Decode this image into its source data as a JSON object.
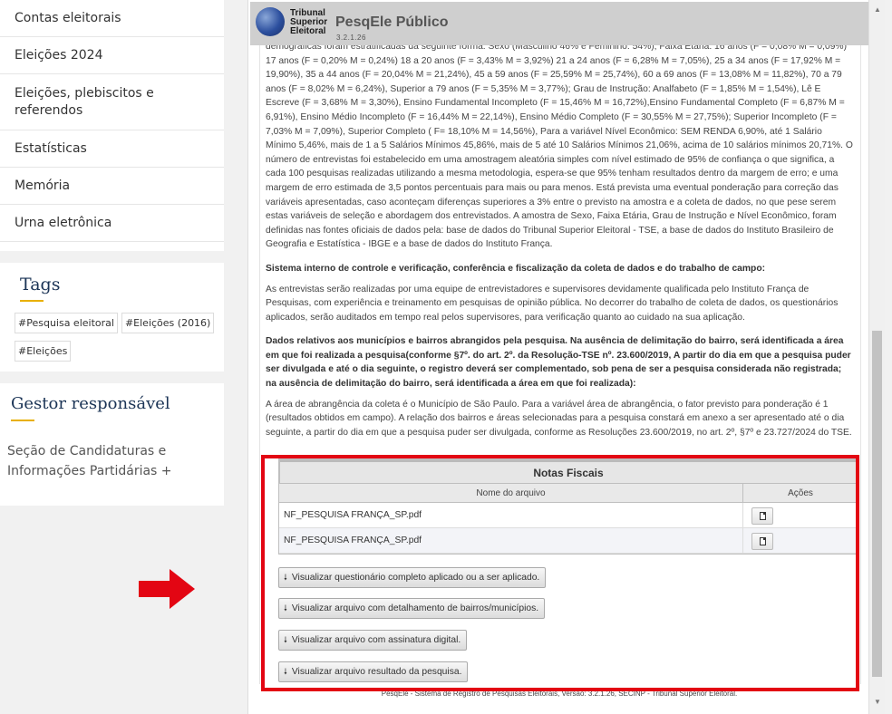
{
  "sidebar": {
    "items": [
      {
        "label": "Contas eleitorais"
      },
      {
        "label": "Eleições 2024"
      },
      {
        "label": "Eleições, plebiscitos e referendos"
      },
      {
        "label": "Estatísticas"
      },
      {
        "label": "Memória"
      },
      {
        "label": "Urna eletrônica"
      }
    ]
  },
  "tags": {
    "title": "Tags",
    "items": [
      "#Pesquisa eleitoral",
      "#Eleições (2016)",
      "#Eleições"
    ]
  },
  "gestor": {
    "title": "Gestor responsável",
    "text": "Seção de Candidaturas e Informações Partidárias +"
  },
  "app": {
    "logo_line1": "Tribunal",
    "logo_line2": "Superior",
    "logo_line3": "Eleitoral",
    "title": "PesqEle Público",
    "version": "3.2.1.26"
  },
  "content": {
    "para1": "demográficas foram estratificadas da seguinte forma: Sexo (Masculino 46% e Feminino: 54%); Faixa Etária: 16 anos (F = 0,08% M = 0,09%) 17 anos (F = 0,20% M = 0,24%) 18 a 20 anos (F = 3,43% M = 3,92%) 21 a 24 anos (F = 6,28% M = 7,05%), 25 a 34 anos (F = 17,92% M = 19,90%), 35 a 44 anos (F = 20,04% M = 21,24%), 45 a 59 anos (F = 25,59% M = 25,74%), 60 a 69 anos (F = 13,08% M = 11,82%), 70 a 79 anos (F = 8,02% M = 6,24%), Superior a 79 anos (F = 5,35% M = 3,77%); Grau de Instrução: Analfabeto (F = 1,85% M = 1,54%), Lê E Escreve (F = 3,68% M = 3,30%), Ensino Fundamental Incompleto (F = 15,46% M = 16,72%),Ensino Fundamental Completo (F = 6,87% M = 6,91%), Ensino Médio Incompleto (F = 16,44% M = 22,14%), Ensino Médio Completo (F = 30,55% M = 27,75%); Superior Incompleto (F = 7,03% M = 7,09%), Superior Completo ( F= 18,10% M = 14,56%), Para a variável Nível Econômico: SEM RENDA 6,90%, até 1 Salário Mínimo 5,46%, mais de 1 a 5 Salários Mínimos 45,86%, mais de 5 até 10 Salários Mínimos 21,06%, acima de 10 salários mínimos 20,71%. O número de entrevistas foi estabelecido em uma amostragem aleatória simples com nível estimado de 95% de confiança o que significa, a cada 100 pesquisas realizadas utilizando a mesma metodologia, espera-se que 95% tenham resultados dentro da margem de erro; e uma margem de erro estimada de 3,5 pontos percentuais para mais ou para menos. Está prevista uma eventual ponderação para correção das variáveis apresentadas, caso aconteçam diferenças superiores a 3% entre o previsto na amostra e a coleta de dados, no que pese serem estas variáveis de seleção e abordagem dos entrevistados. A amostra de Sexo, Faixa Etária, Grau de Instrução e Nível Econômico, foram definidas nas fontes oficiais de dados pela: base de dados do Tribunal Superior Eleitoral - TSE, a base de dados do Instituto Brasileiro de Geografia e Estatística - IBGE e a base de dados do Instituto França.",
    "heading2": "Sistema interno de controle e verificação, conferência e fiscalização da coleta de dados e do trabalho de campo:",
    "para2": "As entrevistas serão realizadas por uma equipe de entrevistadores e supervisores devidamente qualificada pelo Instituto França de Pesquisas, com experiência e treinamento em pesquisas de opinião pública. No decorrer do trabalho de coleta de dados, os questionários aplicados, serão auditados em tempo real pelos supervisores, para verificação quanto ao cuidado na sua aplicação.",
    "heading3": "Dados relativos aos municípios e bairros abrangidos pela pesquisa. Na ausência de delimitação do bairro, será identificada a área em que foi realizada a pesquisa(conforme §7º. do art. 2º. da Resolução-TSE nº. 23.600/2019, A partir do dia em que a pesquisa puder ser divulgada e até o dia seguinte, o registro deverá ser complementado, sob pena de ser a pesquisa considerada não registrada; na ausência de delimitação do bairro, será identificada a área em que foi realizada):",
    "para3": "A área de abrangência da coleta é o Município de São Paulo. Para a variável área de abrangência, o fator previsto para ponderação é 1 (resultados obtidos em campo). A relação dos bairros e áreas selecionadas para a pesquisa constará em anexo a ser apresentado até o dia seguinte, a partir do dia em que a pesquisa puder ser divulgada, conforme as Resoluções 23.600/2019, no art. 2º, §7º e 23.727/2024 do TSE."
  },
  "notas": {
    "caption": "Notas Fiscais",
    "col_file": "Nome do arquivo",
    "col_actions": "Ações",
    "rows": [
      {
        "file": "NF_PESQUISA FRANÇA_SP.pdf"
      },
      {
        "file": "NF_PESQUISA FRANÇA_SP.pdf"
      }
    ]
  },
  "buttons": {
    "questionario": "Visualizar questionário completo aplicado ou a ser aplicado.",
    "bairros": "Visualizar arquivo com detalhamento de bairros/municípios.",
    "assinatura": "Visualizar arquivo com assinatura digital.",
    "resultado": "Visualizar arquivo resultado da pesquisa."
  },
  "footer": "PesqEle - Sistema de Registro de Pesquisas Eleitorais, Versão: 3.2.1.26, SECINP - Tribunal Superior Eleitoral.",
  "colors": {
    "highlight_border": "#e30613",
    "arrow": "#e30613",
    "heading_blue": "#1a3355",
    "accent_yellow": "#e8b000"
  },
  "icons": {
    "arrow": "arrow-right-icon",
    "pdf": "document-icon",
    "download": "download-arrow-icon"
  }
}
